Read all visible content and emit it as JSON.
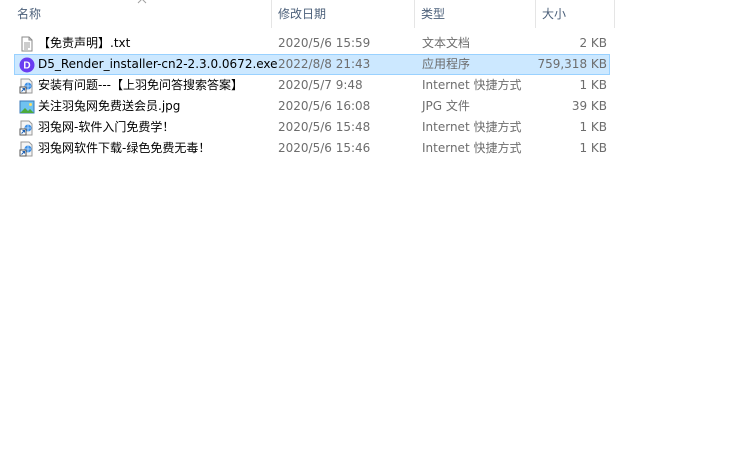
{
  "columns": {
    "name": "名称",
    "date": "修改日期",
    "type": "类型",
    "size": "大小"
  },
  "files": [
    {
      "name": "【免责声明】.txt",
      "date": "2020/5/6 15:59",
      "type": "文本文档",
      "size": "2 KB",
      "icon": "text-file-icon",
      "selected": false
    },
    {
      "name": "D5_Render_installer-cn2-2.3.0.0672.exe",
      "date": "2022/8/8 21:43",
      "type": "应用程序",
      "size": "759,318 KB",
      "icon": "d5-app-icon",
      "selected": true
    },
    {
      "name": "安装有问题---【上羽免问答搜索答案】",
      "date": "2020/5/7 9:48",
      "type": "Internet 快捷方式",
      "size": "1 KB",
      "icon": "internet-shortcut-icon",
      "selected": false
    },
    {
      "name": "关注羽兔网免费送会员.jpg",
      "date": "2020/5/6 16:08",
      "type": "JPG 文件",
      "size": "39 KB",
      "icon": "image-file-icon",
      "selected": false
    },
    {
      "name": "羽兔网-软件入门免费学！",
      "date": "2020/5/6 15:48",
      "type": "Internet 快捷方式",
      "size": "1 KB",
      "icon": "internet-shortcut-icon",
      "selected": false
    },
    {
      "name": "羽兔网软件下载-绿色免费无毒！",
      "date": "2020/5/6 15:46",
      "type": "Internet 快捷方式",
      "size": "1 KB",
      "icon": "internet-shortcut-icon",
      "selected": false
    }
  ],
  "colors": {
    "selection_bg": "#cce8ff",
    "selection_border": "#99d1ff",
    "header_text": "#4c607a",
    "secondary_text": "#6d6d6d"
  }
}
